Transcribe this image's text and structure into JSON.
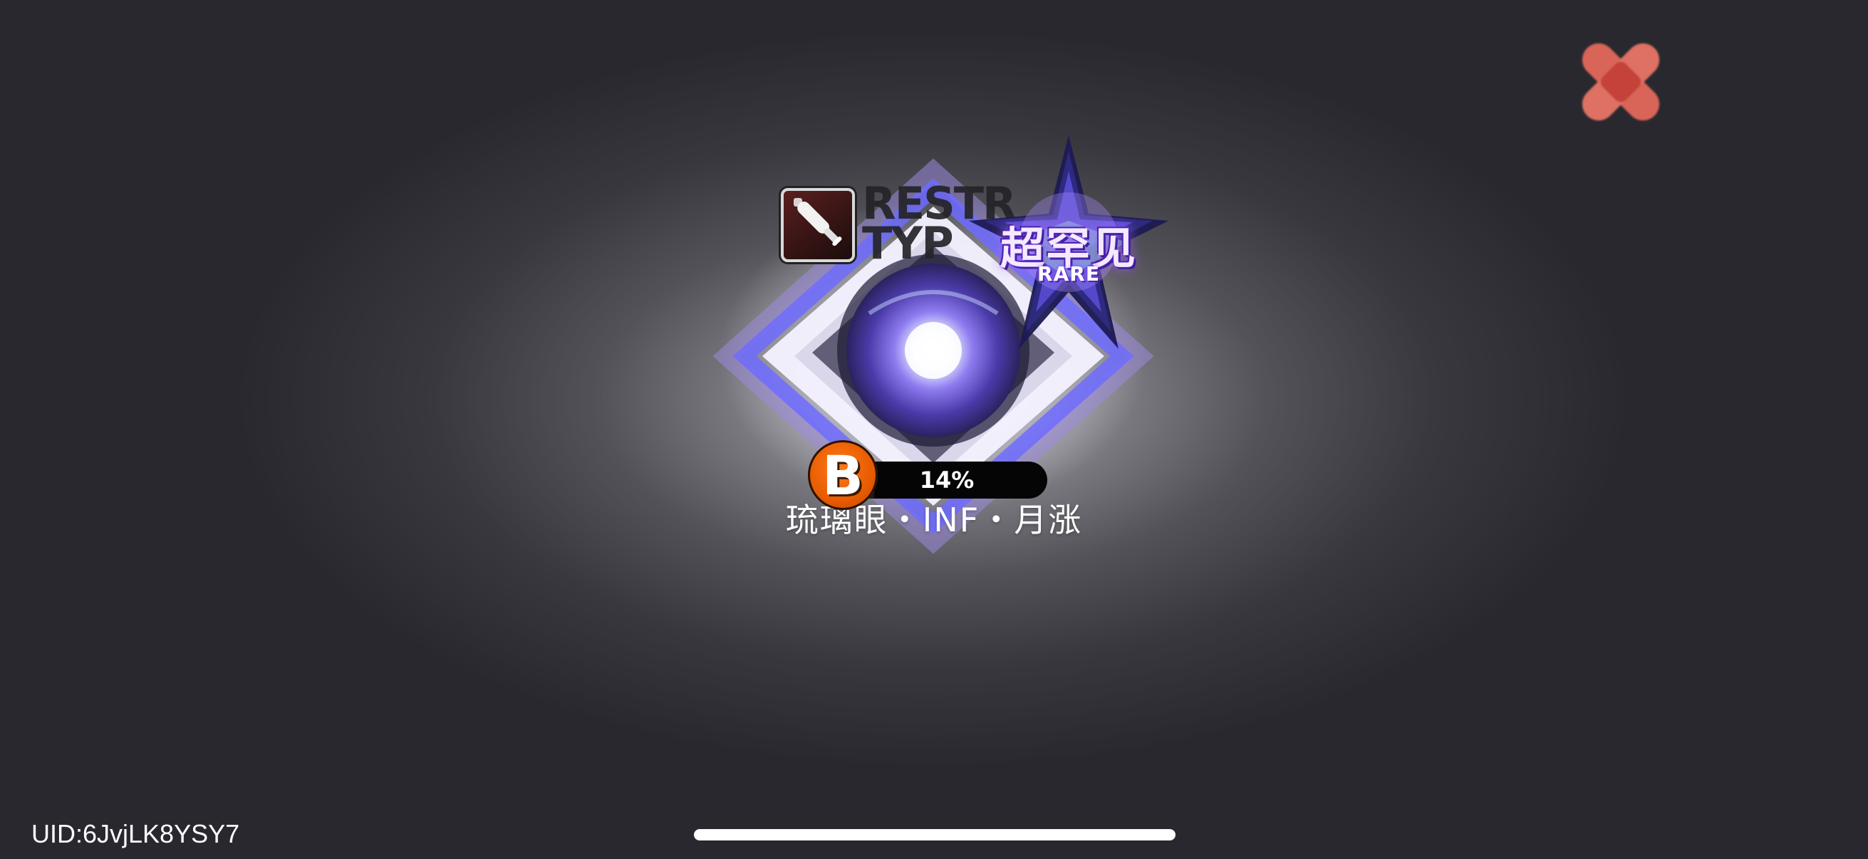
{
  "close_button": {
    "icon": "close-icon",
    "color": "#e86a5c"
  },
  "item": {
    "type_icon": "baseball-bat-icon",
    "type_label": "RESTR\nTYP",
    "rarity_label": "超罕见",
    "rarity_sub": "RARE",
    "artwork": "crystal-eye-icon",
    "grade": "B",
    "progress_percent": 14,
    "progress_label": "14%",
    "name": "琉璃眼・INF・月涨"
  },
  "footer": {
    "uid": "UID:6JvjLK8YSY7"
  },
  "colors": {
    "grade_bg": "#e65a00",
    "rarity_glow": "#7b3cff",
    "diamond_frame": "#8a7bff"
  }
}
